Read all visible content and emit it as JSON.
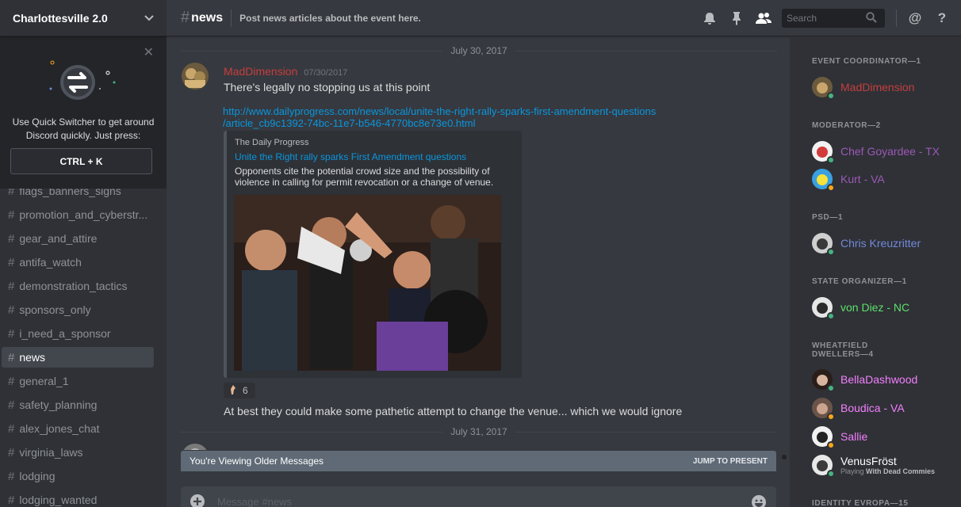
{
  "server": {
    "name": "Charlottesville 2.0"
  },
  "popout": {
    "message": "Use Quick Switcher to get around Discord quickly. Just press:",
    "shortcut": "CTRL + K"
  },
  "channels": [
    {
      "name": "flags_banners_signs"
    },
    {
      "name": "promotion_and_cyberstr..."
    },
    {
      "name": "gear_and_attire"
    },
    {
      "name": "antifa_watch"
    },
    {
      "name": "demonstration_tactics"
    },
    {
      "name": "sponsors_only"
    },
    {
      "name": "i_need_a_sponsor"
    },
    {
      "name": "news",
      "active": true
    },
    {
      "name": "general_1"
    },
    {
      "name": "safety_planning"
    },
    {
      "name": "alex_jones_chat"
    },
    {
      "name": "virginia_laws"
    },
    {
      "name": "lodging"
    },
    {
      "name": "lodging_wanted"
    }
  ],
  "header": {
    "channel_name": "news",
    "topic": "Post news articles about the event here.",
    "search_placeholder": "Search"
  },
  "chat": {
    "date1": "July 30, 2017",
    "message": {
      "author": "MadDimension",
      "timestamp": "07/30/2017",
      "text": "There's legally no stopping us at this point",
      "link_line1": "http://www.dailyprogress.com/news/local/unite-the-right-rally-sparks-first-amendment-questions",
      "link_line2": "/article_cb9c1392-74bc-11e7-b546-4770bc8e73e0.html",
      "embed": {
        "provider": "The Daily Progress",
        "title": "Unite the Right rally sparks First Amendment questions",
        "description": "Opponents cite the potential crowd size and the possibility of violence in calling for permit revocation or a change of venue."
      },
      "reaction_count": "6",
      "followup": "At best they could make some pathetic attempt to change the venue... which we would ignore"
    },
    "date2": "July 31, 2017",
    "older_notice": "You're Viewing Older Messages",
    "jump_label": "JUMP TO PRESENT",
    "composer_placeholder": "Message #news"
  },
  "members": {
    "groups": [
      {
        "label": "EVENT COORDINATOR—1"
      },
      {
        "label": "MODERATOR—2"
      },
      {
        "label": "PSD—1"
      },
      {
        "label": "STATE ORGANIZER—1"
      },
      {
        "label": "WHEATFIELD DWELLERS—4"
      },
      {
        "label": "IDENTITY EVROPA—15"
      }
    ],
    "list": [
      {
        "name": "MadDimension",
        "color": "#c53e3e",
        "status": "online"
      },
      {
        "name": "Chef Goyardee - TX",
        "color": "#9b59b6",
        "status": "online"
      },
      {
        "name": "Kurt - VA",
        "color": "#9b59b6",
        "status": "idle"
      },
      {
        "name": "Chris Kreuzritter",
        "color": "#7289da",
        "status": "online"
      },
      {
        "name": "von Diez - NC",
        "color": "#5ee06c",
        "status": "online"
      },
      {
        "name": "BellaDashwood",
        "color": "#f47fff",
        "status": "online"
      },
      {
        "name": "Boudica - VA",
        "color": "#f47fff",
        "status": "idle"
      },
      {
        "name": "Sallie",
        "color": "#f47fff",
        "status": "idle"
      },
      {
        "name": "VenusFröst",
        "color": "#ffffff",
        "status": "online",
        "activity_prefix": "Playing",
        "activity_name": "With Dead Commies"
      }
    ],
    "status_colors": {
      "online": "#43b581",
      "idle": "#faa61a"
    }
  }
}
